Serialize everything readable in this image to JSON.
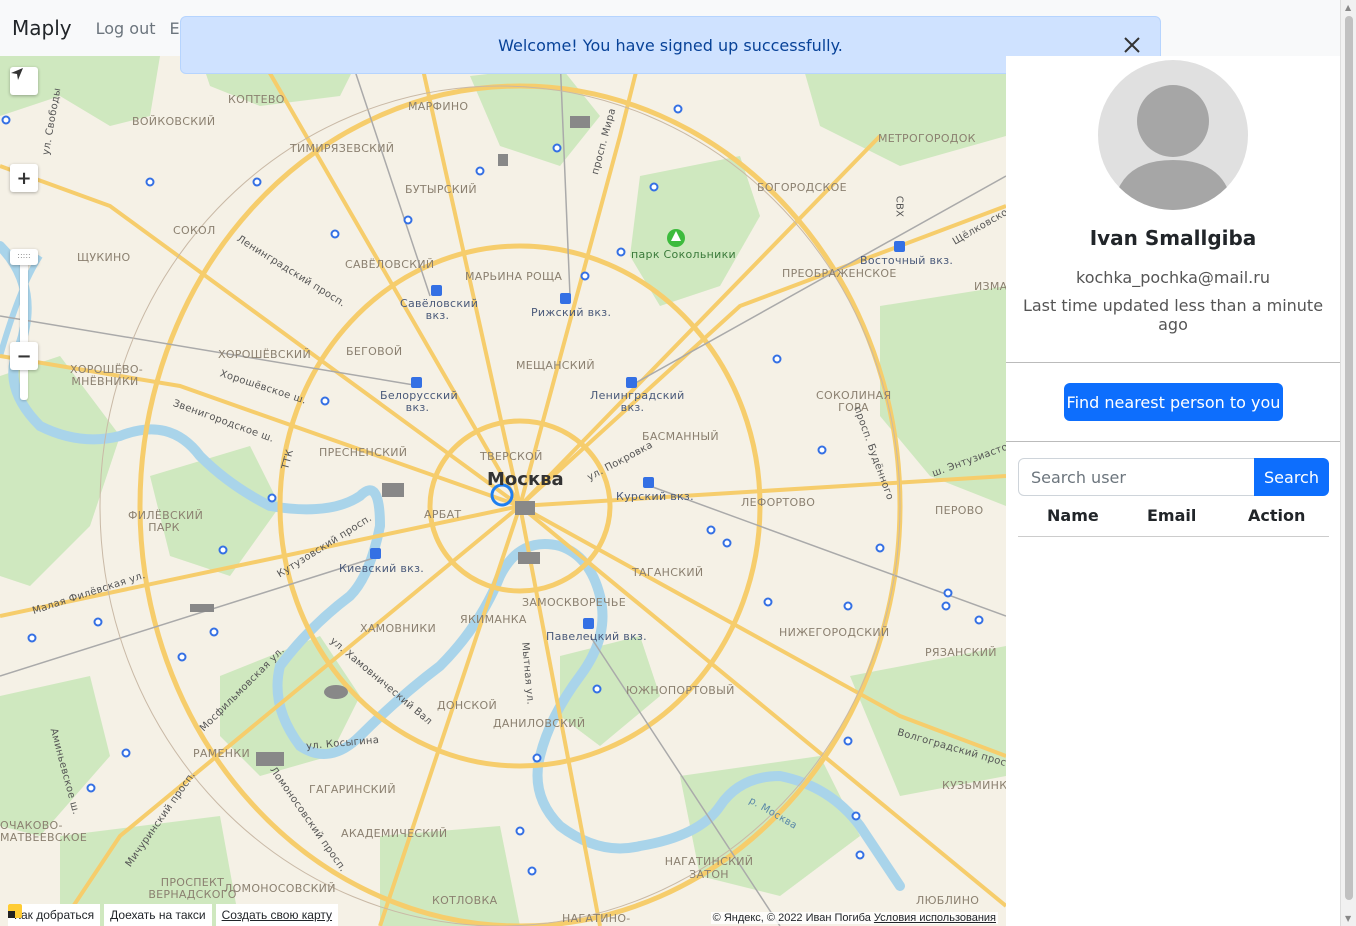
{
  "navbar": {
    "brand": "Maply",
    "links": [
      "Log out",
      "Ed"
    ]
  },
  "alert": {
    "message": "Welcome! You have signed up successfully.",
    "close_icon": "close-icon"
  },
  "map": {
    "city_label": "Москва",
    "districts": [
      "КОПТЕВО",
      "ВОЙКОВСКИЙ",
      "МАРФИНО",
      "ТИМИРЯЗЕВСКИЙ",
      "БУТЫРСКИЙ",
      "СОКОЛ",
      "ЩУКИНО",
      "САВЁЛОВСКИЙ",
      "МАРЬИНА РОЩА",
      "БОГОРОДСКОЕ",
      "МЕТРОГОРОДОК",
      "ПРЕОБРАЖЕНСКОЕ",
      "ХОРОШЁВСКИЙ",
      "БЕГОВОЙ",
      "ХОРОШЁВО-МНЁВНИКИ",
      "МЕЩАНСКИЙ",
      "СОКОЛИНАЯ ГОРА",
      "БАСМАННЫЙ",
      "ПРЕСНЕНСКИЙ",
      "ТВЕРСКОЙ",
      "ЛЕФОРТОВО",
      "ПЕРОВО",
      "ФИЛЁВСКИЙ ПАРК",
      "АРБАТ",
      "ТАГАНСКИЙ",
      "ЗАМОСКВОРЕЧЬЕ",
      "ХАМОВНИКИ",
      "ЯКИМАНКА",
      "НИЖЕГОРОДСКИЙ",
      "РЯЗАНСКИЙ",
      "ЮЖНОПОРТОВЫЙ",
      "ДОНСКОЙ",
      "ДАНИЛОВСКИЙ",
      "РАМЕНКИ",
      "ГАГАРИНСКИЙ",
      "КУЗЬМИНКИ",
      "АКАДЕМИЧЕСКИЙ",
      "НАГАТИНСКИЙ ЗАТОН",
      "ПРОСПЕКТ ВЕРНАДСКОГО",
      "ЛОМОНОСОВСКИЙ",
      "КОТЛОВКА",
      "НАГАТИНО-",
      "ЛЮБЛИНО",
      "ИЗМА",
      "ОЧАКОВО-МАТВЕЕВСКОЕ"
    ],
    "stations": [
      "Савёловский вкз.",
      "Рижский вкз.",
      "Белорусский вкз.",
      "Ленинградский вкз.",
      "Курский вкз.",
      "Киевский вкз.",
      "Павелецкий вкз.",
      "Восточный вкз."
    ],
    "park": "парк Сокольники",
    "roads": [
      "Ленинградский просп.",
      "Звенигородское ш.",
      "Кутузовский просп.",
      "Малая Филёвская ул.",
      "Мосфильмовская ул.",
      "ул. Косыгина",
      "Ломоносовский просп.",
      "Мичуринский просп.",
      "Аминьевское ш.",
      "ул. Покровка",
      "Волгоградский просп.",
      "ш. Энтузиастов",
      "Щёлковское ш.",
      "просп. Мира",
      "просп. Будённого",
      "ул. Хамовнический Вал",
      "Мытная ул.",
      "Хорошёвское ш.",
      "ул. Свободы",
      "ТТК",
      "СВХ",
      "р. Москва"
    ],
    "bottom_bar": {
      "route_label": "Как добраться",
      "taxi_label": "Доехать на такси",
      "create_map_label": "Создать свою карту"
    },
    "copyright": "© Яндекс, © 2022 Иван Погиба",
    "terms": "Условия использования",
    "controls": {
      "zoom_in": "+",
      "zoom_out": "−",
      "zoom_handle": ":::::"
    }
  },
  "profile": {
    "name": "Ivan Smallgiba",
    "email": "kochka_pochka@mail.ru",
    "updated": "Last time updated less than a minute ago",
    "find_button": "Find nearest person to you"
  },
  "search": {
    "placeholder": "Search user",
    "button": "Search"
  },
  "table": {
    "headers": [
      "Name",
      "Email",
      "Action"
    ]
  },
  "colors": {
    "primary": "#0d6efd",
    "alert_bg": "#cfe2ff",
    "alert_text": "#084298",
    "map_bg": "#f5f1e6",
    "road": "#f6cd6c",
    "water": "#a9d4ea",
    "park": "#cfe8bf",
    "metro": "#3470e4"
  }
}
